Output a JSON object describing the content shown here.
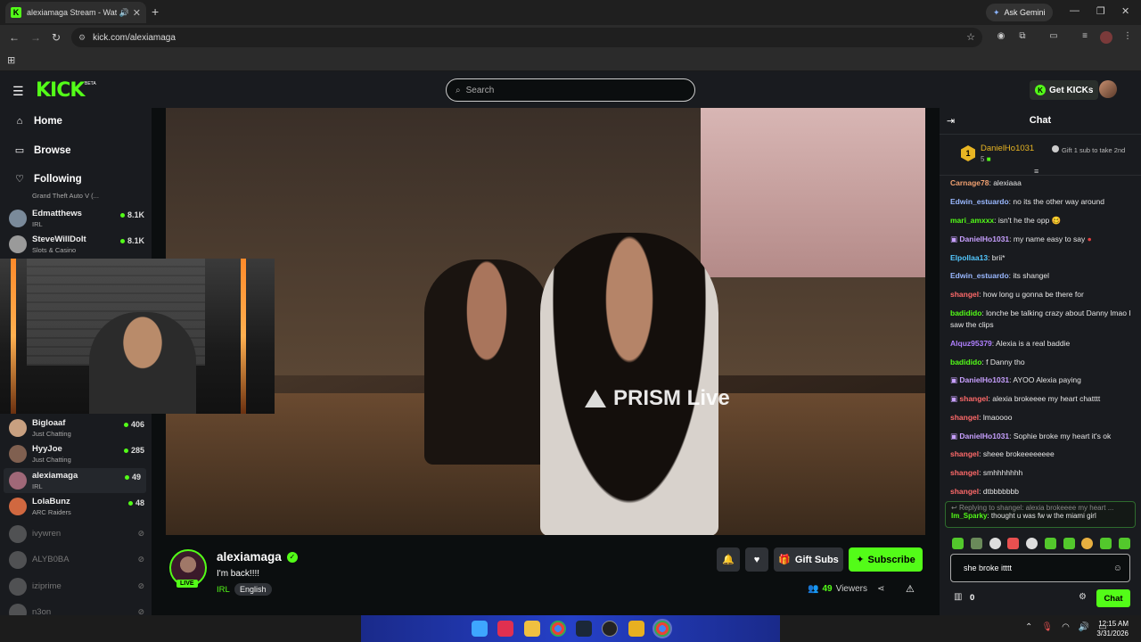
{
  "browser": {
    "tab_title": "alexiamaga Stream - Watch",
    "ask_gemini": "Ask Gemini",
    "url": "kick.com/alexiamaga"
  },
  "header": {
    "logo": "KICK",
    "beta": "BETA",
    "search_placeholder": "Search",
    "get_kicks": "Get KICKs"
  },
  "sidebar": {
    "nav": [
      {
        "label": "Home",
        "icon": "home-icon"
      },
      {
        "label": "Browse",
        "icon": "browse-icon"
      },
      {
        "label": "Following",
        "icon": "heart-icon"
      }
    ],
    "partial_category": "Grand Theft Auto V (...",
    "channels": [
      {
        "name": "Edmatthews",
        "category": "IRL",
        "viewers": "8.1K",
        "color": "#7a8a9a"
      },
      {
        "name": "SteveWillDoIt",
        "category": "Slots & Casino",
        "viewers": "8.1K",
        "color": "#9a9a9a"
      },
      {
        "name": "Bigloaaf",
        "category": "Just Chatting",
        "viewers": "406",
        "color": "#c8a080"
      },
      {
        "name": "HyyJoe",
        "category": "Just Chatting",
        "viewers": "285",
        "color": "#806050"
      },
      {
        "name": "alexiamaga",
        "category": "IRL",
        "viewers": "49",
        "color": "#a06878"
      },
      {
        "name": "LolaBunz",
        "category": "ARC Raiders",
        "viewers": "48",
        "color": "#d06840"
      }
    ],
    "offline": [
      "ivywren",
      "ALYB0BA",
      "iziprime",
      "n3on"
    ]
  },
  "video": {
    "watermark": "PRISM Live"
  },
  "stream": {
    "channel": "alexiamaga",
    "live": "LIVE",
    "title": "I'm back!!!!",
    "category": "IRL",
    "tag": "English",
    "gift_subs": "Gift Subs",
    "subscribe": "Subscribe",
    "viewers_count": "49",
    "viewers_label": "Viewers"
  },
  "chat": {
    "title": "Chat",
    "pinned": {
      "rank": "1",
      "user": "DanielHo1031",
      "count": "5",
      "gift_text": "Gift 1 sub to take 2nd"
    },
    "messages": [
      {
        "user": "Carnage78",
        "text": "alexiaaa",
        "color": "#f0a070"
      },
      {
        "user": "Edwin_estuardo",
        "text": "no its the other way around",
        "color": "#9ab8ff"
      },
      {
        "user": "mari_amxxx",
        "text": "isn't he the opp",
        "color": "#53fc18"
      },
      {
        "user": "DanielHo1031",
        "text": "my name easy to say",
        "color": "#c8a0ff"
      },
      {
        "user": "Elpollaa13",
        "text": "brii*",
        "color": "#53c8ff"
      },
      {
        "user": "Edwin_estuardo",
        "text": "its shangel",
        "color": "#9ab8ff"
      },
      {
        "user": "shangel",
        "text": "how long u gonna be there for",
        "color": "#ff6a6a"
      },
      {
        "user": "badidido",
        "text": "lonche be talking crazy about Danny lmao I saw the clips",
        "color": "#53fc18"
      },
      {
        "user": "Alquz95379",
        "text": "Alexia is a real baddie",
        "color": "#b080ff"
      },
      {
        "user": "badidido",
        "text": "f Danny tho",
        "color": "#53fc18"
      },
      {
        "user": "DanielHo1031",
        "text": "AYOO Alexia paying",
        "color": "#c8a0ff"
      },
      {
        "user": "shangel",
        "text": "alexia brokeeee my heart chatttt",
        "color": "#ff6a6a"
      },
      {
        "user": "shangel",
        "text": "lmaoooo",
        "color": "#ff6a6a"
      },
      {
        "user": "DanielHo1031",
        "text": "Sophie broke my heart it's ok",
        "color": "#c8a0ff"
      },
      {
        "user": "shangel",
        "text": "sheee brokeeeeeeee",
        "color": "#ff6a6a"
      },
      {
        "user": "shangel",
        "text": "smhhhhhhh",
        "color": "#ff6a6a"
      },
      {
        "user": "shangel",
        "text": "dtbbbbbbb",
        "color": "#ff6a6a"
      }
    ],
    "reply_context": "Replying to shangel: alexia brokeeee my heart ...",
    "reply_user": "Im_Sparky",
    "reply_text": "thought u was fw w the miami girl",
    "input_value": "she broke itttt",
    "points": "0",
    "send": "Chat"
  },
  "taskbar": {
    "time": "12:15 AM",
    "date": "3/31/2026"
  }
}
